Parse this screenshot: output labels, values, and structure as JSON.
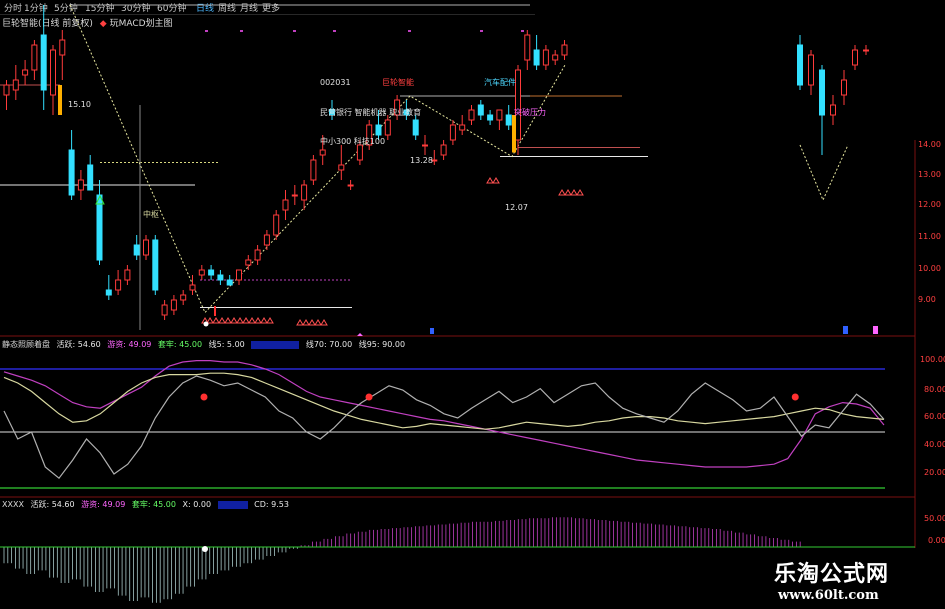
{
  "toolbar": {
    "items": [
      "分时",
      "1分钟",
      "5分钟",
      "15分钟",
      "30分钟",
      "60分钟",
      "日线",
      "周线",
      "月线",
      "更多"
    ],
    "active_index": 6
  },
  "panel_titles": {
    "main": "巨轮智能(日线 前复权)",
    "main_sub": "玩MACD划主图",
    "p2_lead": "静态照顾着盘",
    "p3_lead": "XXXX"
  },
  "info_box": {
    "code": "002031",
    "name": "巨轮智能",
    "industry": "汽车配件",
    "concept1": "民营银行 智能机器 职业教育",
    "concept2": "中小300 科技100"
  },
  "annotations": {
    "high_label": "15.10",
    "mid_label": "13.28",
    "low_label": "12.07",
    "pivot_label": "中枢",
    "breakout_label": "突破压力"
  },
  "price_axis": [
    "14.00",
    "13.00",
    "12.00",
    "11.00",
    "10.00",
    "9.00"
  ],
  "osc_axis": [
    "100.00",
    "80.00",
    "60.00",
    "40.00",
    "20.00"
  ],
  "macd_axis": [
    "50.00",
    "0.00"
  ],
  "panel2_stats": [
    {
      "label": "活跃: 54.60",
      "color": "#e8e8e8"
    },
    {
      "label": "游资: 49.09",
      "color": "#ff66ff"
    },
    {
      "label": "套牢: 45.00",
      "color": "#66ff66"
    },
    {
      "label": "线5: 5.00",
      "color": "#e8e8e8"
    },
    {
      "label": "",
      "color": "#3366ff"
    },
    {
      "label": "线70: 70.00",
      "color": "#e8e8e8"
    },
    {
      "label": "线95: 90.00",
      "color": "#e8e8e8"
    }
  ],
  "panel3_stats": [
    {
      "label": "活跃: 54.60",
      "color": "#e8e8e8"
    },
    {
      "label": "游资: 49.09",
      "color": "#ff66ff"
    },
    {
      "label": "套牢: 45.00",
      "color": "#66ff66"
    },
    {
      "label": "X: 0.00",
      "color": "#e8e8e8"
    },
    {
      "label": "",
      "color": "#3366ff"
    },
    {
      "label": "CD: 9.53",
      "color": "#e8e8e8"
    }
  ],
  "watermark": {
    "line1": "乐淘公式网",
    "line2": "www.60lt.com"
  },
  "colors": {
    "up": "#ff3b3b",
    "down": "#33e0ff",
    "dotted_trend": "#e8e8a0",
    "gray_line": "#b0b0b0",
    "purple": "#c040c0",
    "khaki": "#d8d8a0",
    "blue": "#3030ff",
    "green": "#33cc33"
  },
  "chart_data": {
    "type": "candlestick",
    "title": "巨轮智能(日线 前复权)",
    "ylim": [
      8.6,
      14.6
    ],
    "candles": [
      {
        "o": 13.3,
        "h": 13.6,
        "l": 13.0,
        "c": 13.5
      },
      {
        "o": 13.4,
        "h": 13.9,
        "l": 13.2,
        "c": 13.6
      },
      {
        "o": 13.7,
        "h": 14.0,
        "l": 13.5,
        "c": 13.8
      },
      {
        "o": 13.8,
        "h": 14.4,
        "l": 13.6,
        "c": 14.3
      },
      {
        "o": 14.5,
        "h": 15.1,
        "l": 13.0,
        "c": 13.4
      },
      {
        "o": 13.3,
        "h": 14.3,
        "l": 12.9,
        "c": 14.2
      },
      {
        "o": 14.1,
        "h": 14.6,
        "l": 13.6,
        "c": 14.4
      },
      {
        "o": 12.2,
        "h": 12.6,
        "l": 11.2,
        "c": 11.3
      },
      {
        "o": 11.4,
        "h": 11.8,
        "l": 11.2,
        "c": 11.6
      },
      {
        "o": 11.9,
        "h": 12.1,
        "l": 11.4,
        "c": 11.4
      },
      {
        "o": 11.3,
        "h": 11.6,
        "l": 9.9,
        "c": 10.0
      },
      {
        "o": 9.4,
        "h": 9.7,
        "l": 9.2,
        "c": 9.3
      },
      {
        "o": 9.4,
        "h": 9.8,
        "l": 9.3,
        "c": 9.6
      },
      {
        "o": 9.6,
        "h": 9.9,
        "l": 9.5,
        "c": 9.8
      },
      {
        "o": 10.3,
        "h": 10.5,
        "l": 10.0,
        "c": 10.1
      },
      {
        "o": 10.1,
        "h": 10.5,
        "l": 10.0,
        "c": 10.4
      },
      {
        "o": 10.4,
        "h": 10.5,
        "l": 9.3,
        "c": 9.4
      },
      {
        "o": 8.9,
        "h": 9.2,
        "l": 8.8,
        "c": 9.1
      },
      {
        "o": 9.0,
        "h": 9.3,
        "l": 8.9,
        "c": 9.2
      },
      {
        "o": 9.2,
        "h": 9.4,
        "l": 9.1,
        "c": 9.3
      },
      {
        "o": 9.4,
        "h": 9.7,
        "l": 9.3,
        "c": 9.5
      },
      {
        "o": 9.7,
        "h": 9.9,
        "l": 9.6,
        "c": 9.8
      },
      {
        "o": 9.8,
        "h": 9.9,
        "l": 9.6,
        "c": 9.7
      },
      {
        "o": 9.7,
        "h": 9.8,
        "l": 9.5,
        "c": 9.6
      },
      {
        "o": 9.6,
        "h": 9.7,
        "l": 9.5,
        "c": 9.5
      },
      {
        "o": 9.6,
        "h": 9.8,
        "l": 9.5,
        "c": 9.8
      },
      {
        "o": 9.9,
        "h": 10.1,
        "l": 9.8,
        "c": 10.0
      },
      {
        "o": 10.0,
        "h": 10.3,
        "l": 9.9,
        "c": 10.2
      },
      {
        "o": 10.3,
        "h": 10.6,
        "l": 10.2,
        "c": 10.5
      },
      {
        "o": 10.5,
        "h": 11.0,
        "l": 10.4,
        "c": 10.9
      },
      {
        "o": 11.0,
        "h": 11.4,
        "l": 10.8,
        "c": 11.2
      },
      {
        "o": 11.3,
        "h": 11.5,
        "l": 11.1,
        "c": 11.3
      },
      {
        "o": 11.2,
        "h": 11.6,
        "l": 11.0,
        "c": 11.5
      },
      {
        "o": 11.6,
        "h": 12.1,
        "l": 11.5,
        "c": 12.0
      },
      {
        "o": 12.1,
        "h": 12.5,
        "l": 11.9,
        "c": 12.2
      },
      {
        "o": 13.0,
        "h": 13.2,
        "l": 12.8,
        "c": 12.9
      },
      {
        "o": 11.8,
        "h": 12.3,
        "l": 11.6,
        "c": 11.9
      },
      {
        "o": 11.5,
        "h": 11.6,
        "l": 11.4,
        "c": 11.5
      },
      {
        "o": 12.0,
        "h": 12.4,
        "l": 11.9,
        "c": 12.3
      },
      {
        "o": 12.3,
        "h": 12.8,
        "l": 12.2,
        "c": 12.7
      },
      {
        "o": 12.7,
        "h": 13.0,
        "l": 12.4,
        "c": 12.5
      },
      {
        "o": 12.5,
        "h": 12.9,
        "l": 12.4,
        "c": 12.8
      },
      {
        "o": 12.9,
        "h": 13.3,
        "l": 12.8,
        "c": 13.2
      },
      {
        "o": 13.0,
        "h": 13.2,
        "l": 12.8,
        "c": 12.9
      },
      {
        "o": 12.8,
        "h": 12.9,
        "l": 12.4,
        "c": 12.5
      },
      {
        "o": 12.3,
        "h": 12.5,
        "l": 12.1,
        "c": 12.3
      },
      {
        "o": 12.0,
        "h": 12.2,
        "l": 11.9,
        "c": 12.0
      },
      {
        "o": 12.1,
        "h": 12.4,
        "l": 12.0,
        "c": 12.3
      },
      {
        "o": 12.4,
        "h": 12.8,
        "l": 12.3,
        "c": 12.7
      },
      {
        "o": 12.6,
        "h": 12.9,
        "l": 12.5,
        "c": 12.7
      },
      {
        "o": 12.8,
        "h": 13.1,
        "l": 12.7,
        "c": 13.0
      },
      {
        "o": 13.1,
        "h": 13.2,
        "l": 12.8,
        "c": 12.9
      },
      {
        "o": 12.9,
        "h": 13.0,
        "l": 12.7,
        "c": 12.8
      },
      {
        "o": 12.8,
        "h": 13.0,
        "l": 12.6,
        "c": 13.0
      },
      {
        "o": 12.9,
        "h": 13.1,
        "l": 12.6,
        "c": 12.7
      },
      {
        "o": 12.4,
        "h": 13.9,
        "l": 12.1,
        "c": 13.8
      },
      {
        "o": 14.0,
        "h": 14.6,
        "l": 13.8,
        "c": 14.5
      },
      {
        "o": 14.2,
        "h": 14.5,
        "l": 13.8,
        "c": 13.9
      },
      {
        "o": 13.9,
        "h": 14.3,
        "l": 13.8,
        "c": 14.2
      },
      {
        "o": 14.0,
        "h": 14.2,
        "l": 13.9,
        "c": 14.1
      },
      {
        "o": 14.1,
        "h": 14.4,
        "l": 14.0,
        "c": 14.3
      }
    ],
    "right_candles": [
      {
        "o": 14.3,
        "h": 14.5,
        "l": 13.4,
        "c": 13.5
      },
      {
        "o": 13.5,
        "h": 14.2,
        "l": 13.3,
        "c": 14.1
      },
      {
        "o": 13.8,
        "h": 13.9,
        "l": 12.1,
        "c": 12.9
      },
      {
        "o": 12.9,
        "h": 13.3,
        "l": 12.7,
        "c": 13.1
      },
      {
        "o": 13.3,
        "h": 13.8,
        "l": 13.1,
        "c": 13.6
      },
      {
        "o": 13.9,
        "h": 14.3,
        "l": 13.8,
        "c": 14.2
      },
      {
        "o": 14.2,
        "h": 14.3,
        "l": 14.1,
        "c": 14.2
      }
    ],
    "osc_series": [
      {
        "name": "游资",
        "values": [
          88,
          85,
          82,
          78,
          72,
          66,
          63,
          62,
          67,
          72,
          77,
          85,
          92,
          95,
          96,
          96,
          95,
          95,
          93,
          90,
          86,
          80,
          74,
          70,
          68,
          66,
          64,
          62,
          60,
          58,
          56,
          54,
          53,
          51,
          49,
          47,
          45,
          43,
          41,
          39,
          37,
          35,
          33,
          31,
          29,
          27,
          25,
          24,
          23,
          22,
          21,
          20,
          20,
          20,
          20,
          21,
          22,
          26,
          40,
          58,
          63,
          66,
          65,
          62,
          50
        ]
      },
      {
        "name": "套牢",
        "values": [
          84,
          80,
          74,
          66,
          58,
          52,
          53,
          58,
          66,
          74,
          80,
          84,
          86,
          86,
          86,
          87,
          87,
          86,
          84,
          80,
          76,
          72,
          68,
          64,
          60,
          57,
          54,
          52,
          50,
          48,
          49,
          51,
          50,
          49,
          48,
          47,
          48,
          50,
          52,
          51,
          50,
          49,
          50,
          52,
          53,
          55,
          56,
          56,
          55,
          53,
          52,
          51,
          52,
          53,
          54,
          55,
          56,
          58,
          60,
          62,
          61,
          58,
          56,
          55,
          54
        ]
      },
      {
        "name": "活跃",
        "values": [
          60,
          40,
          45,
          20,
          12,
          25,
          40,
          30,
          15,
          22,
          35,
          55,
          70,
          80,
          85,
          82,
          78,
          80,
          75,
          70,
          60,
          55,
          45,
          40,
          48,
          58,
          66,
          72,
          78,
          75,
          68,
          64,
          58,
          55,
          62,
          68,
          74,
          66,
          70,
          76,
          66,
          72,
          78,
          80,
          70,
          62,
          58,
          55,
          52,
          60,
          72,
          80,
          74,
          68,
          60,
          62,
          70,
          56,
          42,
          50,
          48,
          60,
          72,
          65,
          54
        ]
      }
    ],
    "osc_markers": [
      8,
      20,
      51
    ],
    "macd_values": [
      -18,
      -24,
      -30,
      -26,
      -34,
      -40,
      -36,
      -44,
      -50,
      -46,
      -54,
      -60,
      -56,
      -62,
      -58,
      -52,
      -44,
      -36,
      -30,
      -26,
      -22,
      -18,
      -14,
      -10,
      -6,
      -2,
      2,
      6,
      9,
      12,
      15,
      17,
      19,
      20,
      21,
      22,
      23,
      24,
      25,
      26,
      27,
      28,
      28,
      29,
      30,
      31,
      32,
      32,
      33,
      33,
      32,
      31,
      30,
      29,
      28,
      27,
      26,
      25,
      24,
      23,
      22,
      21,
      20,
      18,
      16,
      14,
      12,
      10,
      8,
      6
    ]
  }
}
